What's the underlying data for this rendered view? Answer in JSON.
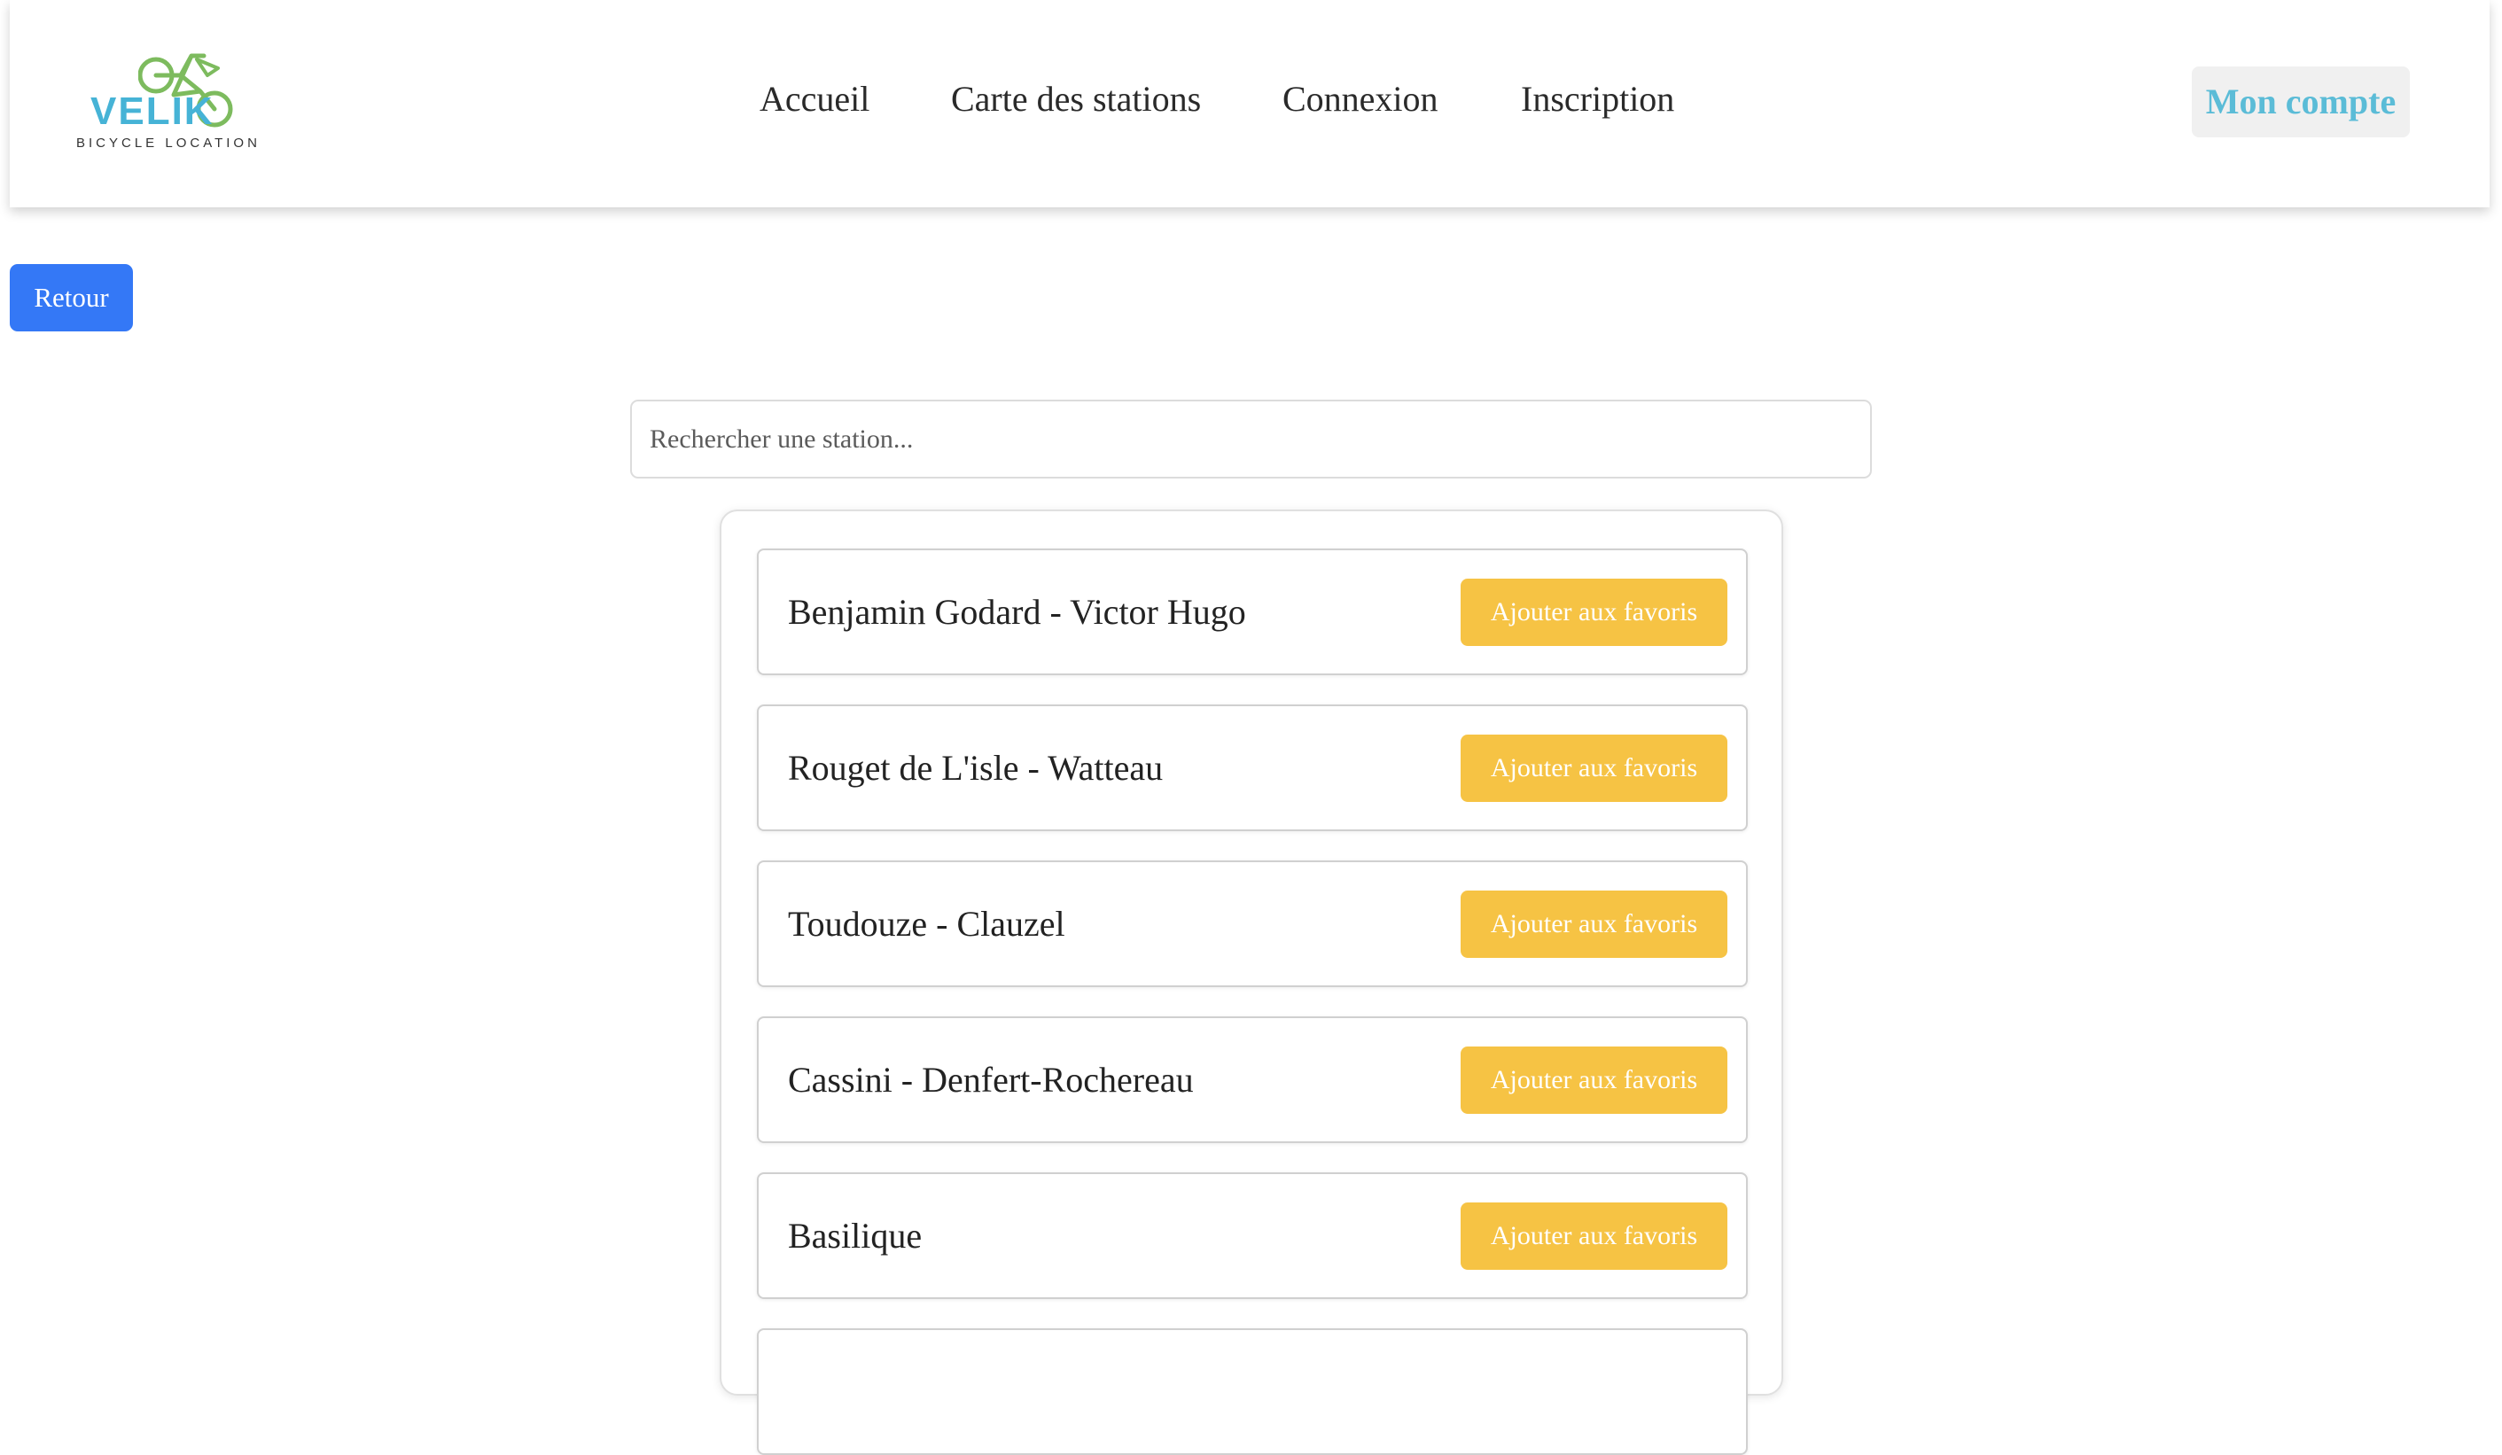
{
  "header": {
    "logo": {
      "name": "VELIK",
      "tagline": "BICYCLE LOCATION"
    },
    "nav": [
      {
        "label": "Accueil"
      },
      {
        "label": "Carte des stations"
      },
      {
        "label": "Connexion"
      },
      {
        "label": "Inscription"
      }
    ],
    "account_label": "Mon compte"
  },
  "back_label": "Retour",
  "search": {
    "placeholder": "Rechercher une station...",
    "value": ""
  },
  "stations": [
    {
      "name": "Benjamin Godard - Victor Hugo",
      "action_label": "Ajouter aux favoris"
    },
    {
      "name": "Rouget de L'isle - Watteau",
      "action_label": "Ajouter aux favoris"
    },
    {
      "name": "Toudouze - Clauzel",
      "action_label": "Ajouter aux favoris"
    },
    {
      "name": "Cassini - Denfert-Rochereau",
      "action_label": "Ajouter aux favoris"
    },
    {
      "name": "Basilique",
      "action_label": "Ajouter aux favoris"
    }
  ],
  "colors": {
    "brand_blue": "#46b3d6",
    "brand_green": "#7dbb5e",
    "primary_button": "#3478f6",
    "favorite_button": "#f6c344",
    "account_text": "#5bbcd7"
  }
}
